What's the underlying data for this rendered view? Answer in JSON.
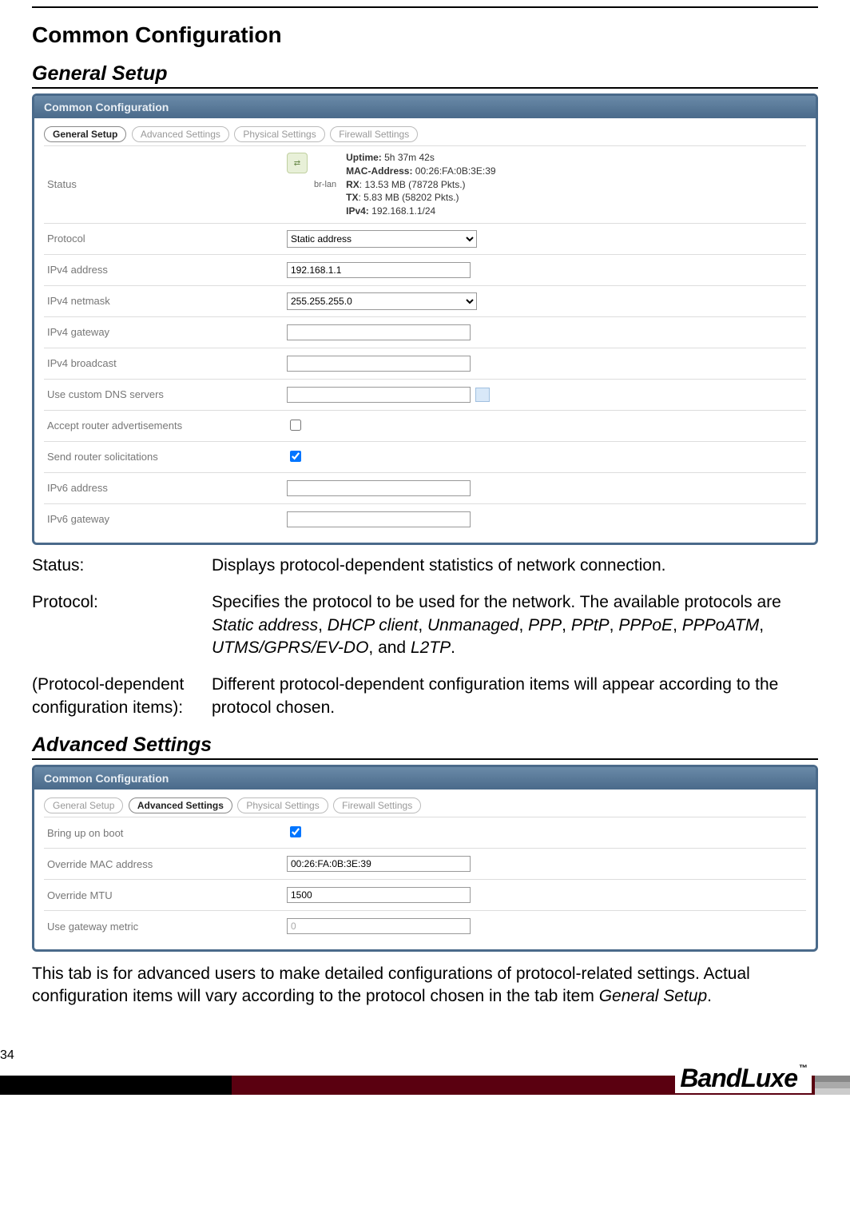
{
  "page_number": "34",
  "main_heading": "Common Configuration",
  "section1_heading": "General Setup",
  "section2_heading": "Advanced Settings",
  "panel_title": "Common Configuration",
  "tabs": {
    "general": "General Setup",
    "advanced": "Advanced Settings",
    "physical": "Physical Settings",
    "firewall": "Firewall Settings"
  },
  "general_form": {
    "status_label": "Status",
    "brlan": "br-lan",
    "uptime_k": "Uptime:",
    "uptime_v": " 5h 37m 42s",
    "mac_k": "MAC-Address:",
    "mac_v": " 00:26:FA:0B:3E:39",
    "rx_k": "RX",
    "rx_v": ": 13.53 MB (78728 Pkts.)",
    "tx_k": "TX",
    "tx_v": ": 5.83 MB (58202 Pkts.)",
    "ipv4_k": "IPv4:",
    "ipv4_v": " 192.168.1.1/24",
    "protocol_label": "Protocol",
    "protocol_value": "Static address",
    "ipv4addr_label": "IPv4 address",
    "ipv4addr_value": "192.168.1.1",
    "ipv4mask_label": "IPv4 netmask",
    "ipv4mask_value": "255.255.255.0",
    "ipv4gw_label": "IPv4 gateway",
    "ipv4gw_value": "",
    "ipv4bc_label": "IPv4 broadcast",
    "ipv4bc_value": "",
    "dns_label": "Use custom DNS servers",
    "dns_value": "",
    "accept_label": "Accept router advertisements",
    "send_label": "Send router solicitations",
    "ipv6addr_label": "IPv6 address",
    "ipv6addr_value": "",
    "ipv6gw_label": "IPv6 gateway",
    "ipv6gw_value": ""
  },
  "desc1_term": "Status:",
  "desc1_def": "Displays protocol-dependent statistics of network connection.",
  "desc2_term": "Protocol:",
  "desc2_a": "Specifies the protocol to be used for the network. The available protocols are ",
  "desc2_p1": "Static address",
  "desc2_s1": ", ",
  "desc2_p2": "DHCP client",
  "desc2_s2": ", ",
  "desc2_p3": "Unmanaged",
  "desc2_s3": ", ",
  "desc2_p4": "PPP",
  "desc2_s4": ", ",
  "desc2_p5": "PPtP",
  "desc2_s5": ", ",
  "desc2_p6": "PPPoE",
  "desc2_s6": ", ",
  "desc2_p7": "PPPoATM",
  "desc2_s7": ", ",
  "desc2_p8": "UTMS/GPRS/EV-DO",
  "desc2_s8": ", and ",
  "desc2_p9": "L2TP",
  "desc2_s9": ".",
  "desc3_term": "(Protocol-dependent configuration items):",
  "desc3_def": "Different protocol-dependent configuration items will appear according to the protocol chosen.",
  "adv_form": {
    "bring_label": "Bring up on boot",
    "mac_label": "Override MAC address",
    "mac_value": "00:26:FA:0B:3E:39",
    "mtu_label": "Override MTU",
    "mtu_value": "1500",
    "gw_label": "Use gateway metric",
    "gw_value": "0"
  },
  "para_a": "This tab is for advanced users to make detailed configurations of protocol-related settings. Actual configuration items will vary according to the protocol chosen in the tab item ",
  "para_b": "General Setup",
  "para_c": ".",
  "logo_text": "BandLuxe",
  "logo_tm": "™"
}
